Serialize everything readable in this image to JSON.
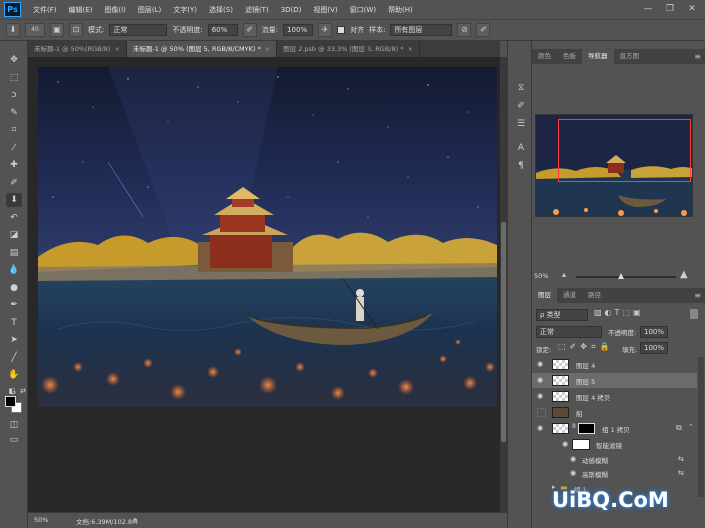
{
  "app": {
    "logo": "Ps"
  },
  "menu": [
    "文件(F)",
    "编辑(E)",
    "图像(I)",
    "图层(L)",
    "文字(Y)",
    "选择(S)",
    "滤镜(T)",
    "3D(D)",
    "视图(V)",
    "窗口(W)",
    "帮助(H)"
  ],
  "window_controls": {
    "minimize": "—",
    "maximize": "❐",
    "close": "✕"
  },
  "options_bar": {
    "brush_size": "40",
    "mode_label": "模式:",
    "mode_value": "正常",
    "opacity_label": "不透明度:",
    "opacity_value": "60%",
    "flow_label": "流量:",
    "flow_value": "100%",
    "aligned_label": "对齐",
    "aligned_checked": true,
    "sample_label": "样本:",
    "sample_value": "所有图层"
  },
  "doc_tabs": [
    {
      "label": "未标题-1 @ 50%(RGB/8)",
      "active": false
    },
    {
      "label": "未标题-1 @ 50% (图层 5, RGB/8/CMYK) *",
      "active": true
    },
    {
      "label": "图层 2.psb @ 33.3% (图层 3, RGB/8) *",
      "active": false
    }
  ],
  "tools": [
    {
      "name": "move-tool-icon",
      "glyph": "✥"
    },
    {
      "name": "marquee-tool-icon",
      "glyph": "⬚"
    },
    {
      "name": "lasso-tool-icon",
      "glyph": "ↄ"
    },
    {
      "name": "quick-select-tool-icon",
      "glyph": "✎"
    },
    {
      "name": "crop-tool-icon",
      "glyph": "⌗"
    },
    {
      "name": "eyedropper-tool-icon",
      "glyph": "⁄"
    },
    {
      "name": "healing-brush-tool-icon",
      "glyph": "✚"
    },
    {
      "name": "brush-tool-icon",
      "glyph": "✐"
    },
    {
      "name": "clone-stamp-tool-icon",
      "glyph": "⬇",
      "active": true
    },
    {
      "name": "history-brush-tool-icon",
      "glyph": "↶"
    },
    {
      "name": "eraser-tool-icon",
      "glyph": "◪"
    },
    {
      "name": "gradient-tool-icon",
      "glyph": "▤"
    },
    {
      "name": "blur-tool-icon",
      "glyph": "💧"
    },
    {
      "name": "dodge-tool-icon",
      "glyph": "●"
    },
    {
      "name": "pen-tool-icon",
      "glyph": "✒"
    },
    {
      "name": "type-tool-icon",
      "glyph": "T"
    },
    {
      "name": "path-select-tool-icon",
      "glyph": "➤"
    },
    {
      "name": "shape-tool-icon",
      "glyph": "╱"
    },
    {
      "name": "hand-tool-icon",
      "glyph": "✋"
    },
    {
      "name": "zoom-tool-icon",
      "glyph": "⌕"
    }
  ],
  "mid_strip_icons": [
    "history-icon",
    "brush-settings-icon",
    "adjust-icon",
    "character-icon",
    "paragraph-icon"
  ],
  "top_panel_tabs": [
    {
      "label": "颜色",
      "active": false
    },
    {
      "label": "色板",
      "active": false
    },
    {
      "label": "导航器",
      "active": true
    },
    {
      "label": "直方图",
      "active": false
    }
  ],
  "navigator": {
    "zoom": "50%"
  },
  "layers_panel": {
    "tabs": [
      {
        "label": "图层",
        "active": true
      },
      {
        "label": "通道",
        "active": false
      },
      {
        "label": "路径",
        "active": false
      }
    ],
    "filter_kind": "ρ 类型",
    "blend_mode": "正常",
    "opacity_label": "不透明度:",
    "opacity_value": "100%",
    "lock_label": "锁定:",
    "fill_label": "填充:",
    "fill_value": "100%",
    "layers": [
      {
        "name": "图层 4",
        "visible": true,
        "selected": false
      },
      {
        "name": "图层 5",
        "visible": true,
        "selected": true
      },
      {
        "name": "图层 4 拷贝",
        "visible": true,
        "selected": false
      },
      {
        "name": "船",
        "visible": false,
        "selected": false
      },
      {
        "name": "组 1 拷贝",
        "visible": true,
        "selected": false
      },
      {
        "name": "智能滤镜",
        "visible": true,
        "selected": false
      },
      {
        "name": "动感模糊",
        "visible": true,
        "selected": false
      },
      {
        "name": "高斯模糊",
        "visible": true,
        "selected": false
      },
      {
        "name": "组 1",
        "visible": false,
        "selected": false
      }
    ]
  },
  "status_bar": {
    "zoom": "50%",
    "doc_info": "文档:6.39M/102.8M"
  },
  "watermark": "UiBQ.CoM",
  "colors": {
    "ui_bg": "#535353",
    "canvas_bg": "#282828",
    "accent": "#31a8ff",
    "selection_frame": "#ff3b3b"
  }
}
